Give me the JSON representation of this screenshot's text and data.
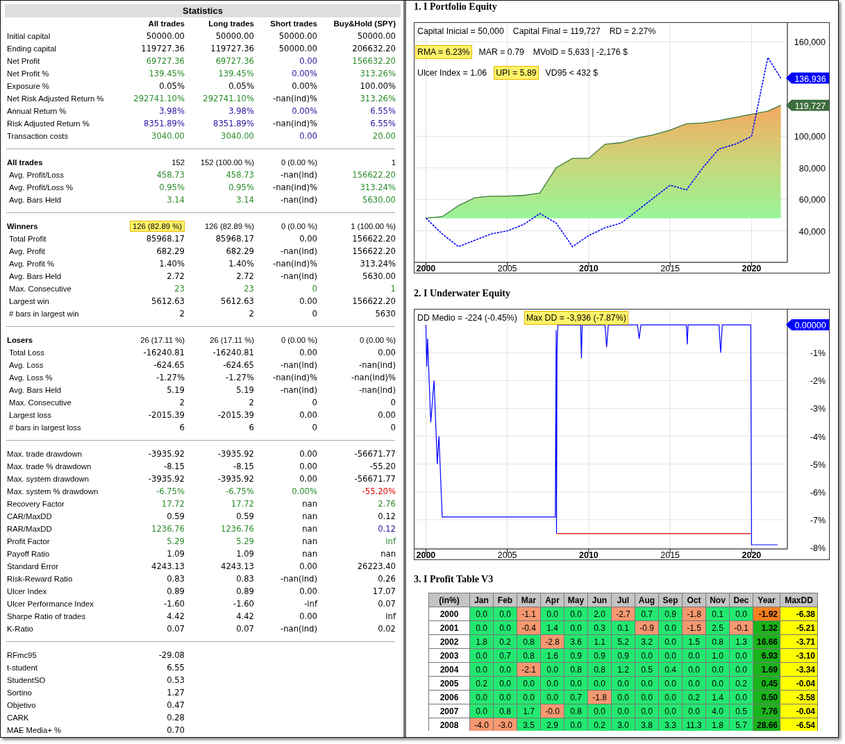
{
  "statistics": {
    "title": "Statistics",
    "columns": [
      "All trades",
      "Long trades",
      "Short trades",
      "Buy&Hold (SPY)"
    ],
    "sections": [
      {
        "rows": [
          {
            "label": "Initial capital",
            "values": [
              {
                "text": "50000.00",
                "color": "#000000"
              },
              {
                "text": "50000.00",
                "color": "#000000"
              },
              {
                "text": "50000.00",
                "color": "#000000"
              },
              {
                "text": "50000.00",
                "color": "#000000"
              }
            ]
          },
          {
            "label": "Ending capital",
            "values": [
              {
                "text": "119727.36",
                "color": "#000000"
              },
              {
                "text": "119727.36",
                "color": "#000000"
              },
              {
                "text": "50000.00",
                "color": "#000000"
              },
              {
                "text": "206632.20",
                "color": "#000000"
              }
            ]
          },
          {
            "label": "Net Profit",
            "values": [
              {
                "text": "69727.36",
                "color": "#2a8a2a"
              },
              {
                "text": "69727.36",
                "color": "#2a8a2a"
              },
              {
                "text": "0.00",
                "color": "#2a10a0"
              },
              {
                "text": "156632.20",
                "color": "#2a8a2a"
              }
            ]
          },
          {
            "label": "Net Profit %",
            "values": [
              {
                "text": "139.45%",
                "color": "#2a8a2a"
              },
              {
                "text": "139.45%",
                "color": "#2a8a2a"
              },
              {
                "text": "0.00%",
                "color": "#2a10a0"
              },
              {
                "text": "313.26%",
                "color": "#2a8a2a"
              }
            ]
          },
          {
            "label": "Exposure %",
            "values": [
              {
                "text": "0.05%",
                "color": "#000000"
              },
              {
                "text": "0.05%",
                "color": "#000000"
              },
              {
                "text": "0.00%",
                "color": "#000000"
              },
              {
                "text": "100.00%",
                "color": "#000000"
              }
            ]
          },
          {
            "label": "Net Risk Adjusted Return %",
            "values": [
              {
                "text": "292741.10%",
                "color": "#2a8a2a"
              },
              {
                "text": "292741.10%",
                "color": "#2a8a2a"
              },
              {
                "text": "-nan(ind)%",
                "color": "#000000"
              },
              {
                "text": "313.26%",
                "color": "#2a8a2a"
              }
            ]
          },
          {
            "label": "Annual Return %",
            "values": [
              {
                "text": "3.98%",
                "color": "#2a10a0"
              },
              {
                "text": "3.98%",
                "color": "#2a10a0"
              },
              {
                "text": "0.00%",
                "color": "#2a10a0"
              },
              {
                "text": "6.55%",
                "color": "#2a10a0"
              }
            ]
          },
          {
            "label": "Risk Adjusted Return %",
            "values": [
              {
                "text": "8351.89%",
                "color": "#2a10a0"
              },
              {
                "text": "8351.89%",
                "color": "#2a10a0"
              },
              {
                "text": "-nan(ind)%",
                "color": "#000000"
              },
              {
                "text": "6.55%",
                "color": "#2a10a0"
              }
            ]
          },
          {
            "label": "Transaction costs",
            "values": [
              {
                "text": "3040.00",
                "color": "#2a8a2a"
              },
              {
                "text": "3040.00",
                "color": "#2a8a2a"
              },
              {
                "text": "0.00",
                "color": "#2a10a0"
              },
              {
                "text": "20.00",
                "color": "#2a8a2a"
              }
            ]
          }
        ]
      },
      {
        "header": {
          "label": "All trades",
          "values": [
            {
              "text": "152"
            },
            {
              "text": "152 (100.00 %)"
            },
            {
              "text": "0 (0.00 %)"
            },
            {
              "text": "1"
            }
          ]
        },
        "rows": [
          {
            "label": "Avg. Profit/Loss",
            "values": [
              {
                "text": "458.73",
                "color": "#2a8a2a"
              },
              {
                "text": "458.73",
                "color": "#2a8a2a"
              },
              {
                "text": "-nan(ind)",
                "color": "#000000"
              },
              {
                "text": "156622.20",
                "color": "#2a8a2a"
              }
            ]
          },
          {
            "label": "Avg. Profit/Loss %",
            "values": [
              {
                "text": "0.95%",
                "color": "#2a8a2a"
              },
              {
                "text": "0.95%",
                "color": "#2a8a2a"
              },
              {
                "text": "-nan(ind)%",
                "color": "#000000"
              },
              {
                "text": "313.24%",
                "color": "#2a8a2a"
              }
            ]
          },
          {
            "label": "Avg. Bars Held",
            "values": [
              {
                "text": "3.14",
                "color": "#2a8a2a"
              },
              {
                "text": "3.14",
                "color": "#2a8a2a"
              },
              {
                "text": "-nan(ind)",
                "color": "#000000"
              },
              {
                "text": "5630.00",
                "color": "#2a8a2a"
              }
            ]
          }
        ]
      },
      {
        "header": {
          "label": "Winners",
          "values": [
            {
              "text": "126 (82.89 %)",
              "highlighted": true
            },
            {
              "text": "126 (82.89 %)",
              "highlighted": false
            },
            {
              "text": "0 (0.00 %)",
              "highlighted": false
            },
            {
              "text": "1 (100.00 %)",
              "highlighted": false
            }
          ]
        },
        "rows": [
          {
            "label": "Total Profit",
            "values": [
              {
                "text": "85968.17",
                "color": "#000000"
              },
              {
                "text": "85968.17",
                "color": "#000000"
              },
              {
                "text": "0.00",
                "color": "#000000"
              },
              {
                "text": "156622.20",
                "color": "#000000"
              }
            ]
          },
          {
            "label": "Avg. Profit",
            "values": [
              {
                "text": "682.29",
                "color": "#000000"
              },
              {
                "text": "682.29",
                "color": "#000000"
              },
              {
                "text": "-nan(ind)",
                "color": "#000000"
              },
              {
                "text": "156622.20",
                "color": "#000000"
              }
            ]
          },
          {
            "label": "Avg. Profit %",
            "values": [
              {
                "text": "1.40%",
                "color": "#000000"
              },
              {
                "text": "1.40%",
                "color": "#000000"
              },
              {
                "text": "-nan(ind)%",
                "color": "#000000"
              },
              {
                "text": "313.24%",
                "color": "#000000"
              }
            ]
          },
          {
            "label": "Avg. Bars Held",
            "values": [
              {
                "text": "2.72",
                "color": "#000000"
              },
              {
                "text": "2.72",
                "color": "#000000"
              },
              {
                "text": "-nan(ind)",
                "color": "#000000"
              },
              {
                "text": "5630.00",
                "color": "#000000"
              }
            ]
          },
          {
            "label": "Max. Consecutive",
            "values": [
              {
                "text": "23",
                "color": "#2a8a2a"
              },
              {
                "text": "23",
                "color": "#2a8a2a"
              },
              {
                "text": "0",
                "color": "#2a8a2a"
              },
              {
                "text": "1",
                "color": "#2a8a2a"
              }
            ]
          },
          {
            "label": "Largest win",
            "values": [
              {
                "text": "5612.63",
                "color": "#000000"
              },
              {
                "text": "5612.63",
                "color": "#000000"
              },
              {
                "text": "0.00",
                "color": "#000000"
              },
              {
                "text": "156622.20",
                "color": "#000000"
              }
            ]
          },
          {
            "label": "# bars in largest win",
            "values": [
              {
                "text": "2",
                "color": "#000000"
              },
              {
                "text": "2",
                "color": "#000000"
              },
              {
                "text": "0",
                "color": "#000000"
              },
              {
                "text": "5630",
                "color": "#000000"
              }
            ]
          }
        ]
      },
      {
        "header": {
          "label": "Losers",
          "values": [
            {
              "text": "26 (17.11 %)"
            },
            {
              "text": "26 (17.11 %)"
            },
            {
              "text": "0 (0.00 %)"
            },
            {
              "text": "0 (0.00 %)"
            }
          ]
        },
        "rows": [
          {
            "label": "Total Loss",
            "values": [
              {
                "text": "-16240.81",
                "color": "#000000"
              },
              {
                "text": "-16240.81",
                "color": "#000000"
              },
              {
                "text": "0.00",
                "color": "#000000"
              },
              {
                "text": "0.00",
                "color": "#000000"
              }
            ]
          },
          {
            "label": "Avg. Loss",
            "values": [
              {
                "text": "-624.65",
                "color": "#000000"
              },
              {
                "text": "-624.65",
                "color": "#000000"
              },
              {
                "text": "-nan(ind)",
                "color": "#000000"
              },
              {
                "text": "-nan(ind)",
                "color": "#000000"
              }
            ]
          },
          {
            "label": "Avg. Loss %",
            "values": [
              {
                "text": "-1.27%",
                "color": "#000000"
              },
              {
                "text": "-1.27%",
                "color": "#000000"
              },
              {
                "text": "-nan(ind)%",
                "color": "#000000"
              },
              {
                "text": "-nan(ind)%",
                "color": "#000000"
              }
            ]
          },
          {
            "label": "Avg. Bars Held",
            "values": [
              {
                "text": "5.19",
                "color": "#000000"
              },
              {
                "text": "5.19",
                "color": "#000000"
              },
              {
                "text": "-nan(ind)",
                "color": "#000000"
              },
              {
                "text": "-nan(ind)",
                "color": "#000000"
              }
            ]
          },
          {
            "label": "Max. Consecutive",
            "values": [
              {
                "text": "2",
                "color": "#000000"
              },
              {
                "text": "2",
                "color": "#000000"
              },
              {
                "text": "0",
                "color": "#000000"
              },
              {
                "text": "0",
                "color": "#000000"
              }
            ]
          },
          {
            "label": "Largest loss",
            "values": [
              {
                "text": "-2015.39",
                "color": "#000000"
              },
              {
                "text": "-2015.39",
                "color": "#000000"
              },
              {
                "text": "0.00",
                "color": "#000000"
              },
              {
                "text": "0.00",
                "color": "#000000"
              }
            ]
          },
          {
            "label": "# bars in largest loss",
            "values": [
              {
                "text": "6",
                "color": "#000000"
              },
              {
                "text": "6",
                "color": "#000000"
              },
              {
                "text": "0",
                "color": "#000000"
              },
              {
                "text": "0",
                "color": "#000000"
              }
            ]
          }
        ]
      },
      {
        "rows": [
          {
            "label": "Max. trade drawdown",
            "values": [
              {
                "text": "-3935.92",
                "color": "#000000"
              },
              {
                "text": "-3935.92",
                "color": "#000000"
              },
              {
                "text": "0.00",
                "color": "#000000"
              },
              {
                "text": "-56671.77",
                "color": "#000000"
              }
            ]
          },
          {
            "label": "Max. trade % drawdown",
            "values": [
              {
                "text": "-8.15",
                "color": "#000000"
              },
              {
                "text": "-8.15",
                "color": "#000000"
              },
              {
                "text": "0.00",
                "color": "#000000"
              },
              {
                "text": "-55.20",
                "color": "#000000"
              }
            ]
          },
          {
            "label": "Max. system drawdown",
            "values": [
              {
                "text": "-3935.92",
                "color": "#000000"
              },
              {
                "text": "-3935.92",
                "color": "#000000"
              },
              {
                "text": "0.00",
                "color": "#000000"
              },
              {
                "text": "-56671.77",
                "color": "#000000"
              }
            ]
          },
          {
            "label": "Max. system % drawdown",
            "values": [
              {
                "text": "-6.75%",
                "color": "#2a8a2a"
              },
              {
                "text": "-6.75%",
                "color": "#2a8a2a"
              },
              {
                "text": "0.00%",
                "color": "#2a8a2a"
              },
              {
                "text": "-55.20%",
                "color": "#e00000"
              }
            ]
          },
          {
            "label": "Recovery Factor",
            "values": [
              {
                "text": "17.72",
                "color": "#2a8a2a"
              },
              {
                "text": "17.72",
                "color": "#2a8a2a"
              },
              {
                "text": "nan",
                "color": "#000000"
              },
              {
                "text": "2.76",
                "color": "#2a8a2a"
              }
            ]
          },
          {
            "label": "CAR/MaxDD",
            "values": [
              {
                "text": "0.59",
                "color": "#000000"
              },
              {
                "text": "0.59",
                "color": "#000000"
              },
              {
                "text": "nan",
                "color": "#000000"
              },
              {
                "text": "0.12",
                "color": "#000000"
              }
            ]
          },
          {
            "label": "RAR/MaxDD",
            "values": [
              {
                "text": "1236.76",
                "color": "#2a8a2a"
              },
              {
                "text": "1236.76",
                "color": "#2a8a2a"
              },
              {
                "text": "nan",
                "color": "#000000"
              },
              {
                "text": "0.12",
                "color": "#2a10a0"
              }
            ]
          },
          {
            "label": "Profit Factor",
            "values": [
              {
                "text": "5.29",
                "color": "#2a8a2a"
              },
              {
                "text": "5.29",
                "color": "#2a8a2a"
              },
              {
                "text": "nan",
                "color": "#000000"
              },
              {
                "text": "inf",
                "color": "#2a8a2a"
              }
            ]
          },
          {
            "label": "Payoff Ratio",
            "values": [
              {
                "text": "1.09",
                "color": "#000000"
              },
              {
                "text": "1.09",
                "color": "#000000"
              },
              {
                "text": "nan",
                "color": "#000000"
              },
              {
                "text": "nan",
                "color": "#000000"
              }
            ]
          },
          {
            "label": "Standard Error",
            "values": [
              {
                "text": "4243.13",
                "color": "#000000"
              },
              {
                "text": "4243.13",
                "color": "#000000"
              },
              {
                "text": "0.00",
                "color": "#000000"
              },
              {
                "text": "26223.40",
                "color": "#000000"
              }
            ]
          },
          {
            "label": "Risk-Reward Ratio",
            "values": [
              {
                "text": "0.83",
                "color": "#000000"
              },
              {
                "text": "0.83",
                "color": "#000000"
              },
              {
                "text": "-nan(ind)",
                "color": "#000000"
              },
              {
                "text": "0.26",
                "color": "#000000"
              }
            ]
          },
          {
            "label": "Ulcer Index",
            "values": [
              {
                "text": "0.89",
                "color": "#000000"
              },
              {
                "text": "0.89",
                "color": "#000000"
              },
              {
                "text": "0.00",
                "color": "#000000"
              },
              {
                "text": "17.07",
                "color": "#000000"
              }
            ]
          },
          {
            "label": "Ulcer Performance Index",
            "values": [
              {
                "text": "-1.60",
                "color": "#000000"
              },
              {
                "text": "-1.60",
                "color": "#000000"
              },
              {
                "text": "-inf",
                "color": "#000000"
              },
              {
                "text": "0.07",
                "color": "#000000"
              }
            ]
          },
          {
            "label": "Sharpe Ratio of trades",
            "values": [
              {
                "text": "4.42",
                "color": "#000000"
              },
              {
                "text": "4.42",
                "color": "#000000"
              },
              {
                "text": "0.00",
                "color": "#000000"
              },
              {
                "text": "inf",
                "color": "#000000"
              }
            ]
          },
          {
            "label": "K-Ratio",
            "values": [
              {
                "text": "0.07",
                "color": "#000000"
              },
              {
                "text": "0.07",
                "color": "#000000"
              },
              {
                "text": "-nan(ind)",
                "color": "#000000"
              },
              {
                "text": "0.02",
                "color": "#000000"
              }
            ]
          }
        ]
      },
      {
        "rows": [
          {
            "label": "RFmc95",
            "values": [
              {
                "text": "-29.08",
                "color": "#000000"
              }
            ]
          },
          {
            "label": "t-student",
            "values": [
              {
                "text": "6.55",
                "color": "#000000"
              }
            ]
          },
          {
            "label": "StudentSO",
            "values": [
              {
                "text": "0.53",
                "color": "#000000"
              }
            ]
          },
          {
            "label": "Sortino",
            "values": [
              {
                "text": "1.27",
                "color": "#000000"
              }
            ]
          },
          {
            "label": "Objetivo",
            "values": [
              {
                "text": "0.47",
                "color": "#000000"
              }
            ]
          },
          {
            "label": "CARK",
            "values": [
              {
                "text": "0.28",
                "color": "#000000"
              }
            ]
          },
          {
            "label": "MAE Media+ %",
            "values": [
              {
                "text": "0.70",
                "color": "#000000"
              }
            ]
          }
        ]
      }
    ]
  },
  "portfolio_equity": {
    "title": "1. I Portfolio Equity",
    "stat_lines": [
      [
        {
          "text": "Capital Inicial = 50,000",
          "highlighted": false
        },
        {
          "text": "Capital Final = 119,727",
          "highlighted": false
        },
        {
          "text": "RD = 2.27%",
          "highlighted": false
        }
      ],
      [
        {
          "text": "RMA = 6.23%",
          "highlighted": true
        },
        {
          "text": "MAR = 0.79",
          "highlighted": false
        },
        {
          "text": "MVolD = 5,633 | -2,176 $",
          "highlighted": false
        }
      ],
      [
        {
          "text": "Ulcer Index = 1.06",
          "highlighted": false
        },
        {
          "text": "UPI = 5.89",
          "highlighted": true
        },
        {
          "text": "VD95 < 432 $",
          "highlighted": false
        }
      ]
    ],
    "price_tags": [
      {
        "text": "136,936",
        "color": "#0000ff"
      },
      {
        "text": "119,727",
        "color": "#3d6e3d"
      }
    ],
    "chart_data": {
      "type": "line",
      "grid": true,
      "x": [
        2000,
        2001,
        2002,
        2003,
        2004,
        2005,
        2006,
        2007,
        2008,
        2009,
        2010,
        2011,
        2012,
        2013,
        2014,
        2015,
        2016,
        2017,
        2018,
        2019,
        2020,
        2021,
        2021.8
      ],
      "series": [
        {
          "type": "area",
          "color": "#3d7a3d",
          "values": [
            48000,
            49000,
            56000,
            61000,
            62000,
            62000,
            62500,
            64000,
            80000,
            86000,
            86000,
            95000,
            96000,
            99000,
            101000,
            104000,
            108000,
            108500,
            110000,
            112000,
            114000,
            116000,
            119700
          ]
        },
        {
          "color": "#0000ff",
          "line_style": "dashed",
          "values": [
            48000,
            38000,
            30000,
            34000,
            38000,
            40000,
            44000,
            51000,
            45000,
            30000,
            37000,
            42000,
            45000,
            53000,
            61000,
            69000,
            66000,
            80000,
            92000,
            95000,
            100000,
            150000,
            136900
          ]
        }
      ],
      "xlim": [
        1999.3,
        2022.2
      ],
      "ylim": [
        20000,
        172000
      ],
      "xticks": [
        {
          "value": 2000,
          "label": "2000"
        },
        {
          "value": 2005,
          "label": "2005"
        },
        {
          "value": 2010,
          "label": "2010"
        },
        {
          "value": 2015,
          "label": "2015"
        },
        {
          "value": 2020,
          "label": "2020"
        }
      ],
      "yticks": [
        {
          "value": 40000,
          "label": "40,000"
        },
        {
          "value": 60000,
          "label": "60,000"
        },
        {
          "value": 80000,
          "label": "80,000"
        },
        {
          "value": 100000,
          "label": "100,000"
        },
        {
          "value": 160000,
          "label": "160,000"
        }
      ]
    }
  },
  "underwater_equity": {
    "title": "2. I Underwater Equity",
    "stat_lines": [
      [
        {
          "text": "DD Medio = -224 (-0.45%)",
          "highlighted": false
        },
        {
          "text": "Max DD = -3,936 (-7.87%)",
          "highlighted": true
        }
      ]
    ],
    "price_tags": [
      {
        "text": "0.00000",
        "color": "#0000ff"
      }
    ],
    "chart_data": {
      "type": "line",
      "grid": true,
      "x": [
        2000,
        2000.05,
        2000.1,
        2000.3,
        2000.5,
        2000.7,
        2000.8,
        2001,
        2007.95,
        2008,
        2008.02,
        2008.05,
        2008.1,
        2009,
        2009.5,
        2009.55,
        2009.6,
        2011,
        2011.1,
        2011.2,
        2013,
        2013.1,
        2013.2,
        2016,
        2016.05,
        2016.1,
        2018,
        2018.1,
        2018.2,
        2019.95,
        2020,
        2020.05,
        2021.6
      ],
      "series": [
        {
          "color": "#0000ff",
          "values": [
            0,
            -1.5,
            -0.5,
            -3.5,
            -2,
            -5,
            -4,
            -6.9,
            -6.9,
            -0.2,
            -7.5,
            -1,
            0,
            0,
            0,
            -1.2,
            0,
            0,
            -0.8,
            0,
            0,
            -0.5,
            0,
            0,
            -0.7,
            0,
            0,
            -1,
            0,
            0,
            -7.9,
            -7.9,
            -7.9
          ]
        },
        {
          "color": "#e00000",
          "values": [
            null,
            null,
            null,
            null,
            null,
            null,
            null,
            null,
            null,
            null,
            null,
            -7.5,
            -7.5,
            -7.5,
            -7.5,
            -7.5,
            -7.5,
            -7.5,
            -7.5,
            -7.5,
            -7.5,
            -7.5,
            -7.5,
            -7.5,
            -7.5,
            -7.5,
            -7.5,
            -7.5,
            -7.5,
            -7.5,
            null,
            null,
            null
          ]
        }
      ],
      "xlim": [
        1999.3,
        2022.2
      ],
      "ylim": [
        -8.05,
        0.55
      ],
      "xticks": [
        {
          "value": 2000,
          "label": "2000"
        },
        {
          "value": 2005,
          "label": "2005"
        },
        {
          "value": 2010,
          "label": "2010"
        },
        {
          "value": 2015,
          "label": "2015"
        },
        {
          "value": 2020,
          "label": "2020"
        }
      ],
      "yticks": [
        {
          "value": -1,
          "label": "-1%"
        },
        {
          "value": -2,
          "label": "-2%"
        },
        {
          "value": -3,
          "label": "-3%"
        },
        {
          "value": -4,
          "label": "-4%"
        },
        {
          "value": -5,
          "label": "-5%"
        },
        {
          "value": -6,
          "label": "-6%"
        },
        {
          "value": -7,
          "label": "-7%"
        },
        {
          "value": -8,
          "label": "-8%"
        }
      ]
    }
  },
  "profit_table": {
    "title": "3. I Profit Table V3",
    "columns": [
      "(in%)",
      "Jan",
      "Feb",
      "Mar",
      "Apr",
      "May",
      "Jun",
      "Jul",
      "Aug",
      "Sep",
      "Oct",
      "Nov",
      "Dec",
      "Year",
      "MaxDD"
    ],
    "rows": [
      {
        "year": "2000",
        "months": [
          "0.0",
          "0.0",
          "-1.1",
          "0.0",
          "0.0",
          "2.0",
          "-2.7",
          "0.7",
          "0.9",
          "-1.8",
          "0.1",
          "0.0"
        ],
        "losses": [
          false,
          false,
          true,
          false,
          false,
          false,
          true,
          false,
          false,
          true,
          false,
          false
        ],
        "total": "-1.92",
        "total_loss": true,
        "maxdd": "-6.38"
      },
      {
        "year": "2001",
        "months": [
          "0.0",
          "0.0",
          "-0.4",
          "1.4",
          "0.0",
          "0.3",
          "0.1",
          "-0.9",
          "0.0",
          "-1.5",
          "2.5",
          "-0.1"
        ],
        "losses": [
          false,
          false,
          true,
          false,
          false,
          false,
          false,
          true,
          false,
          true,
          false,
          true
        ],
        "total": "1.32",
        "total_loss": false,
        "maxdd": "-5.21"
      },
      {
        "year": "2002",
        "months": [
          "1.8",
          "0.2",
          "0.8",
          "-2.8",
          "3.6",
          "1.1",
          "5.2",
          "3.2",
          "0.0",
          "1.5",
          "0.8",
          "1.3"
        ],
        "losses": [
          false,
          false,
          false,
          true,
          false,
          false,
          false,
          false,
          false,
          false,
          false,
          false
        ],
        "total": "16.66",
        "total_loss": false,
        "maxdd": "-3.71"
      },
      {
        "year": "2003",
        "months": [
          "0.0",
          "0.7",
          "0.8",
          "1.6",
          "0.9",
          "0.9",
          "0.9",
          "0.0",
          "0.0",
          "0.0",
          "1.0",
          "0.0"
        ],
        "losses": [
          false,
          false,
          false,
          false,
          false,
          false,
          false,
          false,
          false,
          false,
          false,
          false
        ],
        "total": "6.93",
        "total_loss": false,
        "maxdd": "-3.10"
      },
      {
        "year": "2004",
        "months": [
          "0.0",
          "0.0",
          "-2.1",
          "0.0",
          "0.8",
          "0.8",
          "1.2",
          "0.5",
          "0.4",
          "0.0",
          "0.0",
          "0.0"
        ],
        "losses": [
          false,
          false,
          true,
          false,
          false,
          false,
          false,
          false,
          false,
          false,
          false,
          false
        ],
        "total": "1.69",
        "total_loss": false,
        "maxdd": "-3.34"
      },
      {
        "year": "2005",
        "months": [
          "0.2",
          "0.0",
          "0.0",
          "0.0",
          "0.0",
          "0.0",
          "0.0",
          "0.0",
          "0.0",
          "0.0",
          "0.0",
          "0.2"
        ],
        "losses": [
          false,
          false,
          false,
          false,
          false,
          false,
          false,
          false,
          false,
          false,
          false,
          false
        ],
        "total": "0.45",
        "total_loss": false,
        "maxdd": "-0.04"
      },
      {
        "year": "2006",
        "months": [
          "0.0",
          "0.0",
          "0.0",
          "0.0",
          "0.7",
          "-1.8",
          "0.0",
          "0.0",
          "0.0",
          "0.2",
          "1.4",
          "0.0"
        ],
        "losses": [
          false,
          false,
          false,
          false,
          false,
          true,
          false,
          false,
          false,
          false,
          false,
          false
        ],
        "total": "0.50",
        "total_loss": false,
        "maxdd": "-3.58"
      },
      {
        "year": "2007",
        "months": [
          "0.0",
          "0.8",
          "1.7",
          "-0.0",
          "0.8",
          "0.0",
          "0.0",
          "0.0",
          "0.0",
          "0.0",
          "4.0",
          "0.5"
        ],
        "losses": [
          false,
          false,
          false,
          true,
          false,
          false,
          false,
          false,
          false,
          false,
          false,
          false
        ],
        "total": "7.76",
        "total_loss": false,
        "maxdd": "-0.04"
      },
      {
        "year": "2008",
        "months": [
          "-4.0",
          "-3.0",
          "3.5",
          "2.9",
          "0.0",
          "0.2",
          "3.0",
          "3.8",
          "3.3",
          "11.3",
          "1.8",
          "5.7"
        ],
        "losses": [
          true,
          true,
          false,
          false,
          false,
          false,
          false,
          false,
          false,
          false,
          false,
          false
        ],
        "total": "28.66",
        "total_loss": false,
        "maxdd": "-6.54"
      }
    ]
  }
}
